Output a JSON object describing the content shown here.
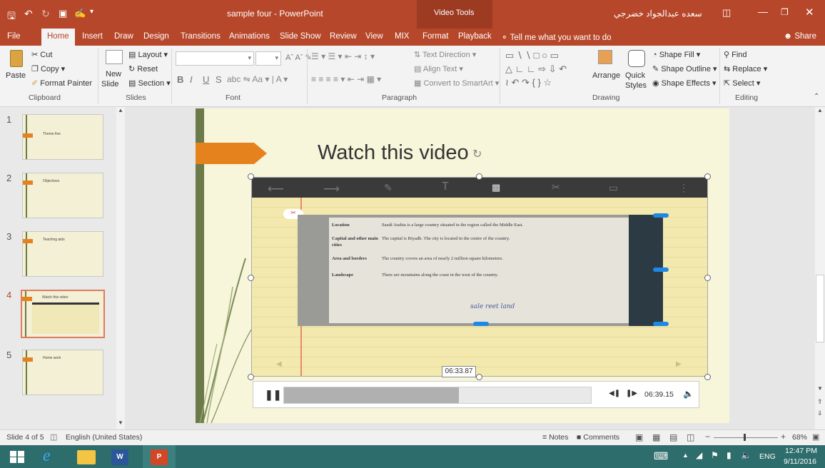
{
  "window": {
    "title": "sample four - PowerPoint",
    "context_tab_group": "Video Tools",
    "user_name": "سعده عبدالجواد خضرجي"
  },
  "tabs": [
    "File",
    "Home",
    "Insert",
    "Draw",
    "Design",
    "Transitions",
    "Animations",
    "Slide Show",
    "Review",
    "View",
    "MIX",
    "Format",
    "Playback"
  ],
  "tell_me": "Tell me what you want to do",
  "share": "Share",
  "ribbon": {
    "clipboard": {
      "paste": "Paste",
      "cut": "Cut",
      "copy": "Copy",
      "format_painter": "Format Painter",
      "label": "Clipboard"
    },
    "slides": {
      "new_slide_1": "New",
      "new_slide_2": "Slide",
      "layout": "Layout",
      "reset": "Reset",
      "section": "Section",
      "label": "Slides"
    },
    "font": {
      "bold": "B",
      "italic": "I",
      "underline": "U",
      "strike": "S",
      "label": "Font"
    },
    "paragraph": {
      "text_direction": "Text Direction",
      "align_text": "Align Text",
      "convert_smartart": "Convert to SmartArt",
      "label": "Paragraph"
    },
    "drawing": {
      "arrange": "Arrange",
      "quick_styles_1": "Quick",
      "quick_styles_2": "Styles",
      "shape_fill": "Shape Fill",
      "shape_outline": "Shape Outline",
      "shape_effects": "Shape Effects",
      "label": "Drawing"
    },
    "editing": {
      "find": "Find",
      "replace": "Replace",
      "select": "Select",
      "label": "Editing"
    }
  },
  "thumbnails": [
    {
      "num": "1",
      "title": "Theme five"
    },
    {
      "num": "2",
      "title": "Objectives"
    },
    {
      "num": "3",
      "title": "Teaching aids"
    },
    {
      "num": "4",
      "title": "Watch this video"
    },
    {
      "num": "5",
      "title": "Home work"
    }
  ],
  "slide": {
    "title": "Watch this video",
    "video": {
      "hover_time": "06:33.87",
      "total_time": "06:39.15",
      "progress": 0.57,
      "doc_rows": [
        {
          "label": "Location",
          "text": "Saudi Arabia is a large country situated in the region called the Middle East."
        },
        {
          "label": "Capital and other main cities",
          "text": "The capital is Riyadh. The city is located in the centre of the country."
        },
        {
          "label": "Area and borders",
          "text": "The country covers an area of nearly 2 million square kilometres."
        },
        {
          "label": "Landscape",
          "text": "There are mountains along the coast in the west of the country."
        }
      ],
      "handwriting": "sale reet land"
    }
  },
  "status": {
    "slide": "Slide 4 of 5",
    "language": "English (United States)",
    "notes": "Notes",
    "comments": "Comments",
    "zoom": "68%"
  },
  "taskbar": {
    "lang": "ENG",
    "time": "12:47 PM",
    "date": "9/11/2016"
  },
  "colors": {
    "accent": "#b7472a",
    "slide_bg": "#f7f5da",
    "orange": "#e6821e",
    "taskbar": "#2d6d6b"
  }
}
